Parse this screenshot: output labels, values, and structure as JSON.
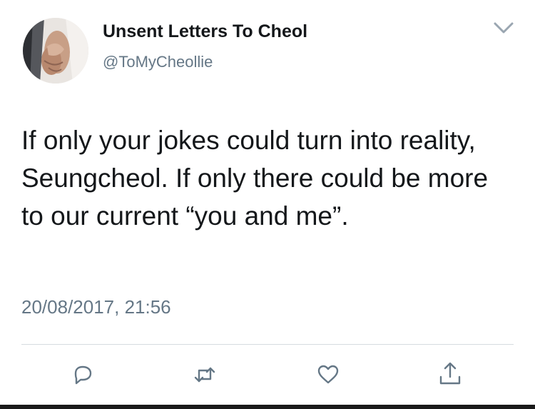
{
  "tweet": {
    "display_name": "Unsent Letters To Cheol",
    "handle": "@ToMyCheollie",
    "text": "If only your jokes could turn into reality, Seungcheol. If only there could be more to our current “you and me”.",
    "timestamp": "20/08/2017, 21:56"
  },
  "icons": {
    "avatar": "avatar-holding-hands",
    "menu": "chevron-down-icon",
    "reply": "reply-icon",
    "retweet": "retweet-icon",
    "like": "heart-icon",
    "share": "share-icon"
  },
  "colors": {
    "text_primary": "#14171a",
    "text_secondary": "#657786",
    "icon": "#657786",
    "divider": "#d6dbe0"
  }
}
